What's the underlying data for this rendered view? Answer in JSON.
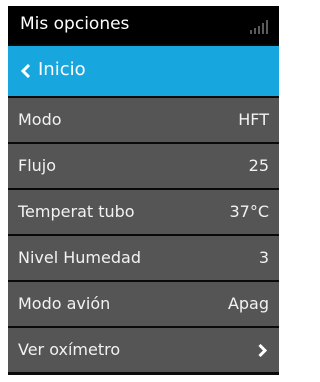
{
  "header": {
    "title": "Mis opciones",
    "signal_icon": "signal-bars-icon"
  },
  "home": {
    "label": "Inicio",
    "icon": "chevron-left-icon",
    "color": "#17a7de"
  },
  "menu": {
    "row_color": "#555555",
    "items": [
      {
        "label": "Modo",
        "value": "HFT"
      },
      {
        "label": "Flujo",
        "value": "25"
      },
      {
        "label": "Temperat tubo",
        "value": "37°C"
      },
      {
        "label": "Nivel Humedad",
        "value": "3"
      },
      {
        "label": "Modo avión",
        "value": "Apag"
      },
      {
        "label": "Ver oxímetro",
        "value": "",
        "icon": "chevron-right-icon"
      }
    ]
  }
}
